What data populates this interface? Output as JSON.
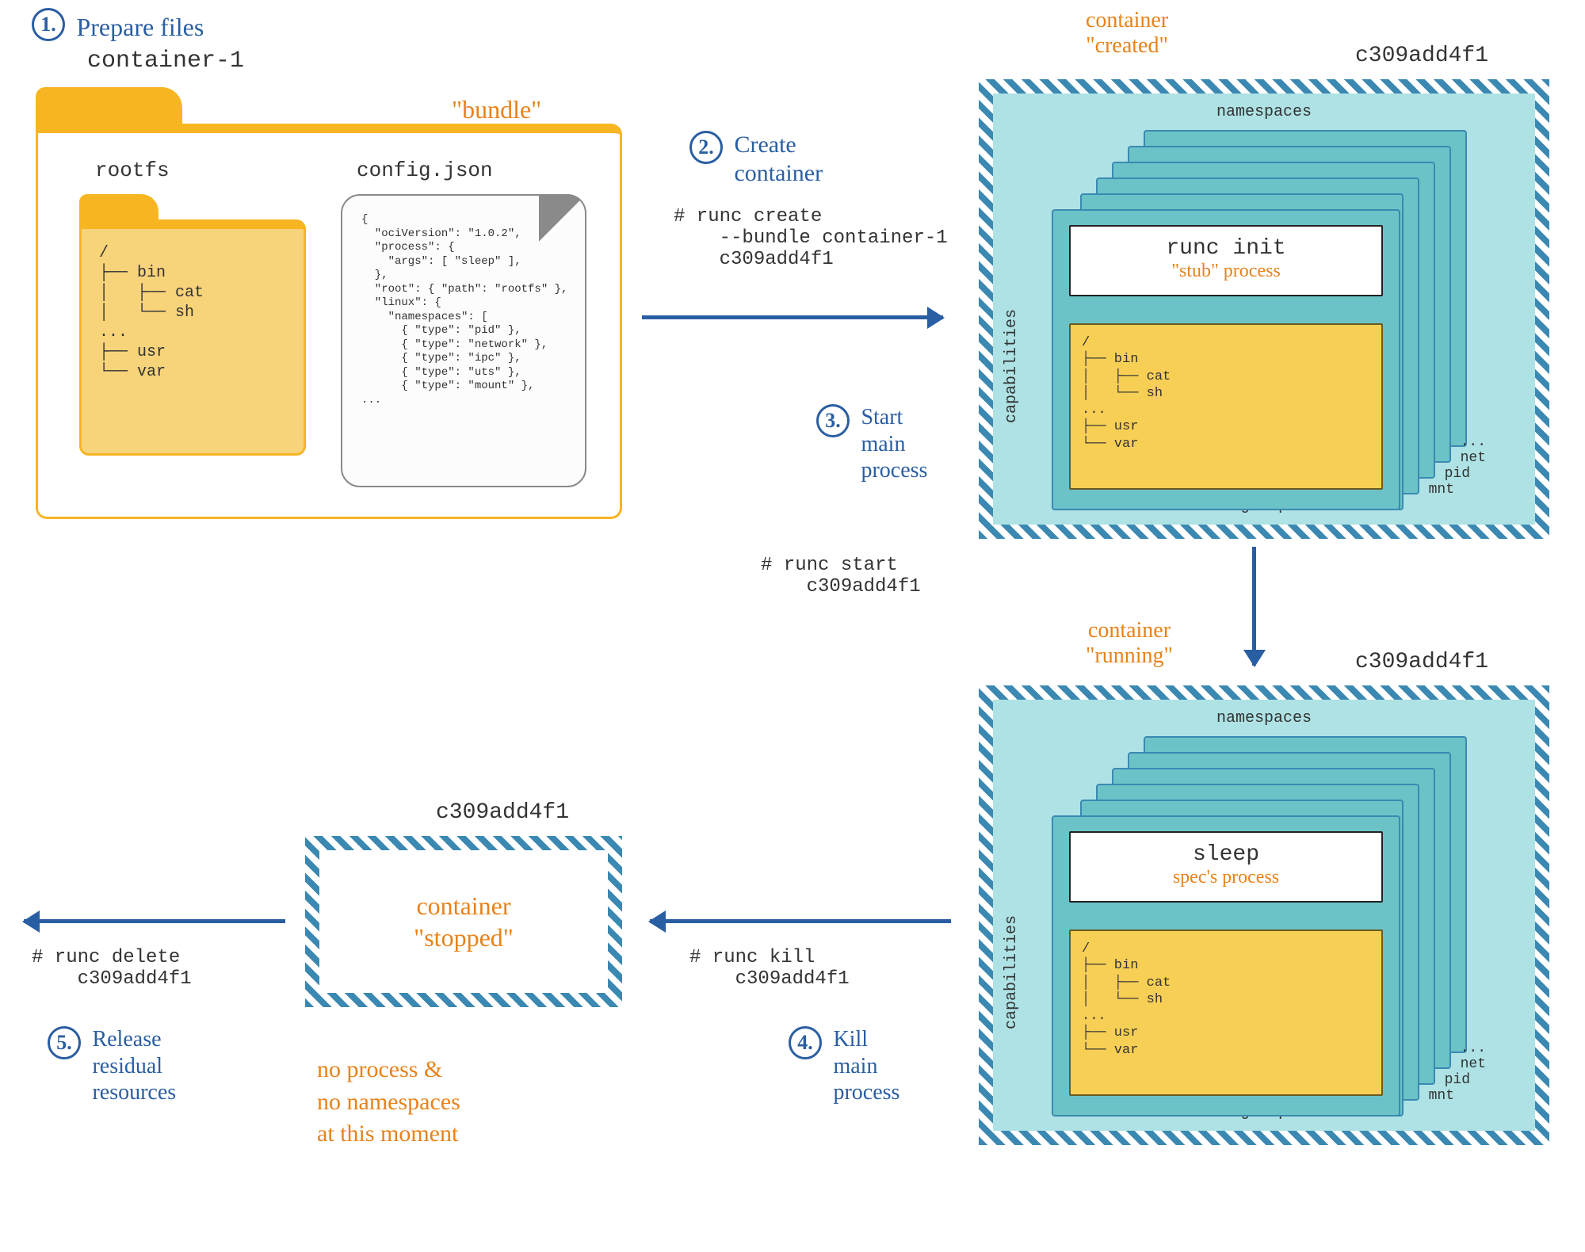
{
  "step1": {
    "num": "1.",
    "title": "Prepare files",
    "bundle_name": "container-1",
    "bundle_tag": "\"bundle\"",
    "rootfs_label": "rootfs",
    "tree_lines": [
      "/",
      "├── bin",
      "│   ├── cat",
      "│   └── sh",
      "...",
      "├── usr",
      "└── var"
    ],
    "config_label": "config.json",
    "config_lines": [
      "{",
      "  \"ociVersion\": \"1.0.2\",",
      "  \"process\": {",
      "    \"args\": [ \"sleep\" ],",
      "  },",
      "  \"root\": { \"path\": \"rootfs\" },",
      "  \"linux\": {",
      "    \"namespaces\": [",
      "      { \"type\": \"pid\" },",
      "      { \"type\": \"network\" },",
      "      { \"type\": \"ipc\" },",
      "      { \"type\": \"uts\" },",
      "      { \"type\": \"mount\" },",
      "..."
    ]
  },
  "step2": {
    "num": "2.",
    "title": "Create\ncontainer",
    "cmd": "# runc create\n    --bundle container-1\n    c309add4f1"
  },
  "created": {
    "tag": "container\n\"created\"",
    "id": "c309add4f1",
    "namespaces": "namespaces",
    "capabilities": "capabilities",
    "cgroups": "cgroups",
    "proc_name": "runc init",
    "proc_note": "\"stub\" process",
    "fs_lines": [
      "/",
      "├── bin",
      "│   ├── cat",
      "│   └── sh",
      "...",
      "├── usr",
      "└── var"
    ],
    "ns_tags": [
      "...",
      "net",
      "pid",
      "mnt"
    ]
  },
  "step3": {
    "num": "3.",
    "title": "Start\nmain\nprocess",
    "cmd": "# runc start\n    c309add4f1"
  },
  "running": {
    "tag": "container\n\"running\"",
    "id": "c309add4f1",
    "proc_name": "sleep",
    "proc_note": "spec's process",
    "fs_lines": [
      "/",
      "├── bin",
      "│   ├── cat",
      "│   └── sh",
      "...",
      "├── usr",
      "└── var"
    ],
    "namespaces": "namespaces",
    "capabilities": "capabilities",
    "cgroups": "cgroups",
    "ns_tags": [
      "...",
      "net",
      "pid",
      "mnt"
    ]
  },
  "step4": {
    "num": "4.",
    "title": "Kill\nmain\nprocess",
    "cmd": "# runc kill\n    c309add4f1"
  },
  "stopped": {
    "id": "c309add4f1",
    "tag": "container\n\"stopped\"",
    "note": "no process &\nno namespaces\nat this moment"
  },
  "step5": {
    "num": "5.",
    "title": "Release\nresidual\nresources",
    "cmd": "# runc delete\n    c309add4f1"
  }
}
